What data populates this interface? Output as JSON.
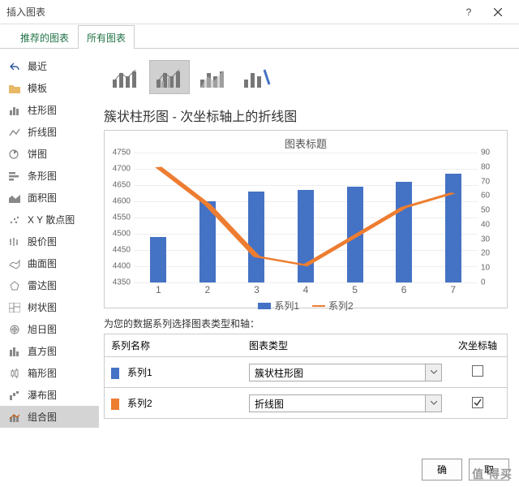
{
  "window": {
    "title": "插入图表"
  },
  "tabs": {
    "recommended": "推荐的图表",
    "all": "所有图表"
  },
  "sidebar": {
    "items": [
      {
        "label": "最近"
      },
      {
        "label": "模板"
      },
      {
        "label": "柱形图"
      },
      {
        "label": "折线图"
      },
      {
        "label": "饼图"
      },
      {
        "label": "条形图"
      },
      {
        "label": "面积图"
      },
      {
        "label": "X Y 散点图"
      },
      {
        "label": "股价图"
      },
      {
        "label": "曲面图"
      },
      {
        "label": "雷达图"
      },
      {
        "label": "树状图"
      },
      {
        "label": "旭日图"
      },
      {
        "label": "直方图"
      },
      {
        "label": "箱形图"
      },
      {
        "label": "瀑布图"
      },
      {
        "label": "组合图"
      }
    ]
  },
  "heading": "簇状柱形图 - 次坐标轴上的折线图",
  "chart_title": "图表标题",
  "legend": {
    "s1": "系列1",
    "s2": "系列2"
  },
  "section_label": "为您的数据系列选择图表类型和轴：",
  "grid": {
    "h1": "系列名称",
    "h2": "图表类型",
    "h3": "次坐标轴",
    "rows": [
      {
        "name": "系列1",
        "type": "簇状柱形图",
        "secondary": false,
        "color": "#4472c4"
      },
      {
        "name": "系列2",
        "type": "折线图",
        "secondary": true,
        "color": "#ed7d31"
      }
    ]
  },
  "buttons": {
    "ok": "确",
    "cancel": "取"
  },
  "watermark": "值   得买",
  "chart_data": {
    "type": "combo",
    "categories": [
      1,
      2,
      3,
      4,
      5,
      6,
      7
    ],
    "series": [
      {
        "name": "系列1",
        "type": "bar",
        "axis": "primary",
        "values": [
          4490,
          4600,
          4630,
          4635,
          4645,
          4660,
          4685
        ]
      },
      {
        "name": "系列2",
        "type": "line",
        "axis": "secondary",
        "values": [
          80,
          54,
          18,
          12,
          32,
          52,
          62
        ]
      }
    ],
    "ylim_primary": [
      4350,
      4750
    ],
    "yticks_primary": [
      4350,
      4400,
      4450,
      4500,
      4550,
      4600,
      4650,
      4700,
      4750
    ],
    "ylim_secondary": [
      0,
      90
    ],
    "yticks_secondary": [
      0,
      10,
      20,
      30,
      40,
      50,
      60,
      70,
      80,
      90
    ],
    "title": "图表标题"
  }
}
